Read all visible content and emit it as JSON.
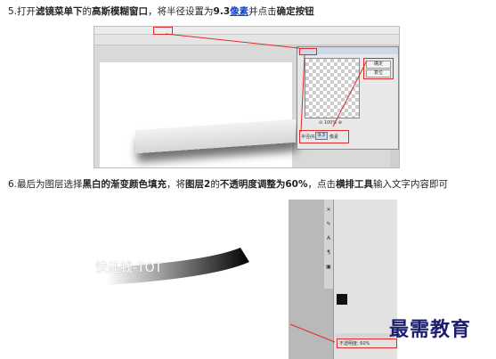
{
  "step5": {
    "p1": "5.打开",
    "b1": "滤镜菜单下",
    "p2": "的",
    "b2": "高斯模糊窗口",
    "p3": "，将半径设置为",
    "b3": "9.3",
    "link": "像素",
    "p4": "并点击",
    "b4": "确定按钮"
  },
  "step6": {
    "p1": "6.最后为图层选择",
    "b1": "黑白的渐变颜色填充",
    "p2": "，将",
    "b2": "图层2",
    "p3": "的",
    "b3": "不透明度调整为60%",
    "p4": "，点击",
    "b4": "横排工具",
    "p5": "输入文字内容即可"
  },
  "screenshot1": {
    "dialog_ok": "确定",
    "dialog_reset": "复位",
    "zoom": "100%",
    "radius_label": "半径(R):",
    "radius_value": "9.3",
    "radius_unit": "像素"
  },
  "screenshot2": {
    "canvas_text": "快还钱-TOT",
    "opacity_label": "不透明度: 60%"
  },
  "watermark": "最需教育"
}
